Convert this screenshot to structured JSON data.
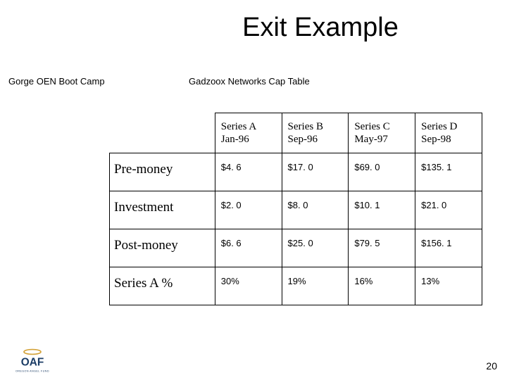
{
  "title": "Exit Example",
  "top_left_label": "Gorge OEN Boot Camp",
  "subtitle": "Gadzoox Networks Cap Table",
  "page_number": "20",
  "logo_text_top": "OAF",
  "logo_text_sub": "OREGON ANGEL FUND",
  "columns": [
    {
      "name": "Series A",
      "date": "Jan-96"
    },
    {
      "name": "Series B",
      "date": "Sep-96"
    },
    {
      "name": "Series C",
      "date": "May-97"
    },
    {
      "name": "Series D",
      "date": "Sep-98"
    }
  ],
  "rows": [
    {
      "label": "Pre-money",
      "values": [
        "$4. 6",
        "$17. 0",
        "$69. 0",
        "$135. 1"
      ]
    },
    {
      "label": "Investment",
      "values": [
        "$2. 0",
        "$8. 0",
        "$10. 1",
        "$21. 0"
      ]
    },
    {
      "label": "Post-money",
      "values": [
        "$6. 6",
        "$25. 0",
        "$79. 5",
        "$156. 1"
      ]
    },
    {
      "label": "Series A %",
      "values": [
        "30%",
        "19%",
        "16%",
        "13%"
      ]
    }
  ],
  "chart_data": {
    "type": "table",
    "title": "Gadzoox Networks Cap Table",
    "columns": [
      "Series A Jan-96",
      "Series B Sep-96",
      "Series C May-97",
      "Series D Sep-98"
    ],
    "rows": [
      "Pre-money",
      "Investment",
      "Post-money",
      "Series A %"
    ],
    "values": [
      [
        "$4.6",
        "$17.0",
        "$69.0",
        "$135.1"
      ],
      [
        "$2.0",
        "$8.0",
        "$10.1",
        "$21.0"
      ],
      [
        "$6.6",
        "$25.0",
        "$79.5",
        "$156.1"
      ],
      [
        "30%",
        "19%",
        "16%",
        "13%"
      ]
    ]
  }
}
